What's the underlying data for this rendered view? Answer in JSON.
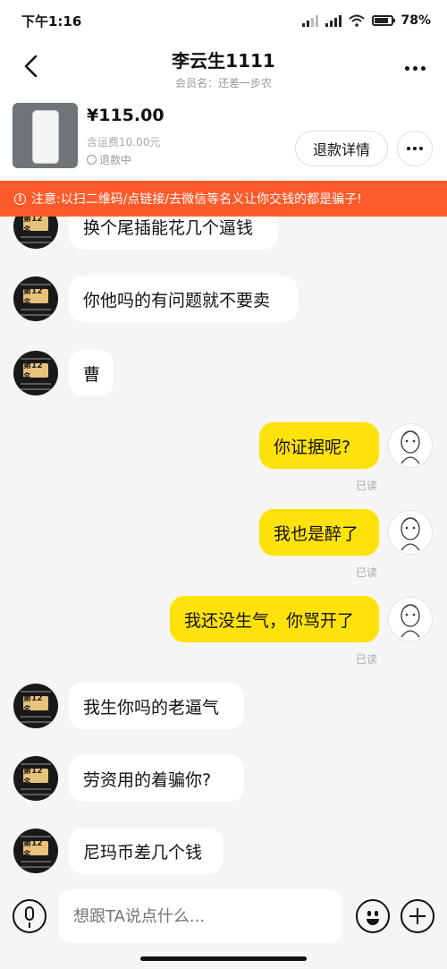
{
  "status_bar": {
    "time": "下午1:16",
    "battery": "78%",
    "battery_level": 0.78
  },
  "header": {
    "title": "李云生1111",
    "subtitle": "会员名：还差一步农"
  },
  "item": {
    "price": "¥115.00",
    "shipping": "含运费10.00元",
    "status": "退款中",
    "refund_button": "退款详情"
  },
  "warning": {
    "text": "注意:以扫二维码/点链接/去微信等名义让你交钱的都是骗子!"
  },
  "avatar_badge": "第12名",
  "messages": [
    {
      "side": "left",
      "text": "换个尾插能花几个逼钱"
    },
    {
      "side": "left",
      "text": "你他吗的有问题就不要卖"
    },
    {
      "side": "left",
      "text": "曹"
    },
    {
      "side": "right",
      "text": "你证据呢?",
      "status": "已读"
    },
    {
      "side": "right",
      "text": "我也是醉了",
      "status": "已读"
    },
    {
      "side": "right",
      "text": "我还没生气，你骂开了",
      "status": "已读"
    },
    {
      "side": "left",
      "text": "我生你吗的老逼气"
    },
    {
      "side": "left",
      "text": "劳资用的着骗你?"
    },
    {
      "side": "left",
      "text": "尼玛币差几个钱"
    }
  ],
  "input": {
    "placeholder": "想跟TA说点什么..."
  }
}
